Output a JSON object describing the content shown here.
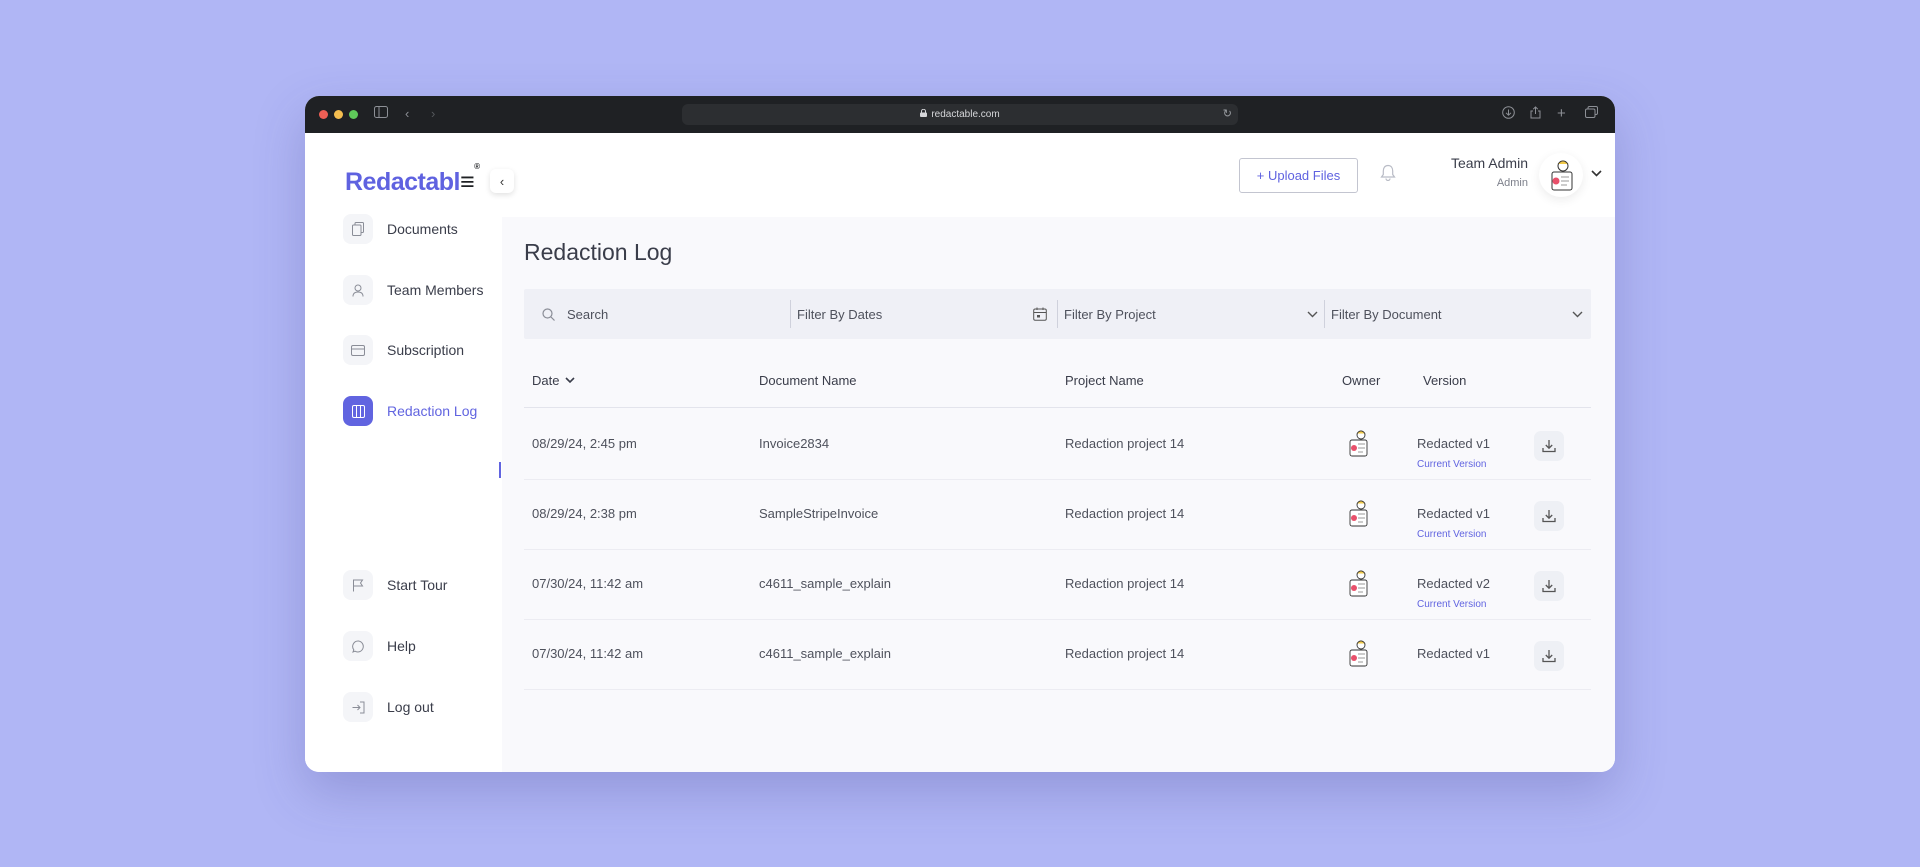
{
  "browser": {
    "url": "redactable.com",
    "traffic_colors": [
      "#ee5f55",
      "#f3bd4f",
      "#5fc95a"
    ]
  },
  "brand": {
    "logo_text": "Redactabl",
    "logo_bars": "≡",
    "logo_mark": "®",
    "accent": "#6164e0"
  },
  "sidebar": {
    "items": [
      {
        "label": "Documents",
        "icon": "documents-icon"
      },
      {
        "label": "Team Members",
        "icon": "user-icon"
      },
      {
        "label": "Subscription",
        "icon": "credit-card-icon"
      },
      {
        "label": "Redaction Log",
        "icon": "log-book-icon",
        "active": true
      }
    ],
    "bottom_items": [
      {
        "label": "Start Tour",
        "icon": "flag-icon"
      },
      {
        "label": "Help",
        "icon": "chat-bubble-icon"
      },
      {
        "label": "Log out",
        "icon": "logout-icon"
      }
    ]
  },
  "header": {
    "upload_label": "+ Upload Files",
    "user_name": "Team Admin",
    "user_role": "Admin"
  },
  "main": {
    "title": "Redaction Log",
    "filters": {
      "search_placeholder": "Search",
      "dates_placeholder": "Filter By Dates",
      "project_placeholder": "Filter By Project",
      "document_placeholder": "Filter By Document"
    },
    "columns": [
      "Date",
      "Document Name",
      "Project Name",
      "Owner",
      "Version"
    ],
    "rows": [
      {
        "date": "08/29/24, 2:45 pm",
        "document": "Invoice2834",
        "project": "Redaction project 14",
        "version": "Redacted v1",
        "current": "Current Version"
      },
      {
        "date": "08/29/24, 2:38 pm",
        "document": "SampleStripeInvoice",
        "project": "Redaction project 14",
        "version": "Redacted v1",
        "current": "Current Version"
      },
      {
        "date": "07/30/24, 11:42 am",
        "document": "c4611_sample_explain",
        "project": "Redaction project 14",
        "version": "Redacted v2",
        "current": "Current Version"
      },
      {
        "date": "07/30/24, 11:42 am",
        "document": "c4611_sample_explain",
        "project": "Redaction project 14",
        "version": "Redacted v1",
        "current": ""
      }
    ]
  }
}
